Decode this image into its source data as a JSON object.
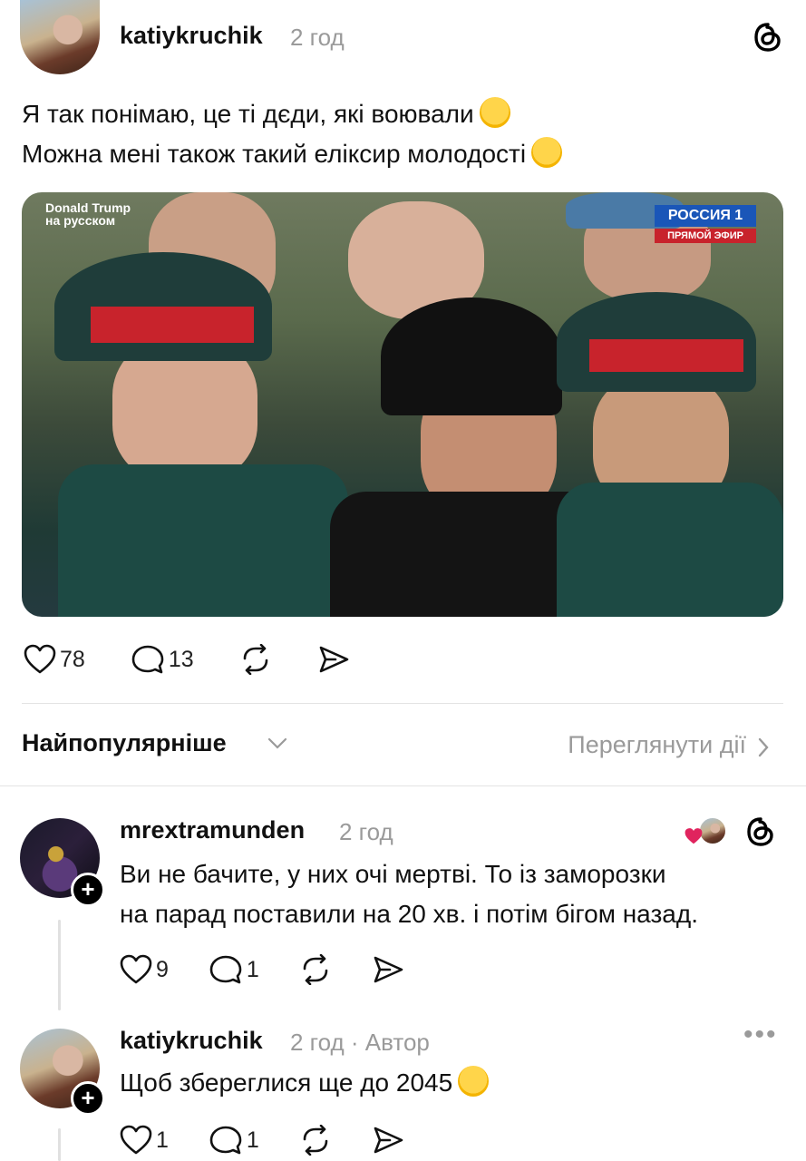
{
  "post": {
    "username": "katiykruchik",
    "time": "2 год",
    "text_line1": "Я так понімаю, це ті дєди, які воювали",
    "text_line2": "Можна мені також такий еліксир молодості",
    "photo_watermark_left": "Donald Trump\nна русском",
    "photo_watermark_right_channel": "РОССИЯ 1",
    "photo_watermark_right_live": "ПРЯМОЙ ЭФИР",
    "likes": "78",
    "comments": "13"
  },
  "sort": {
    "label": "Найпопулярніше",
    "activity_link": "Переглянути дії"
  },
  "replies": [
    {
      "username": "mrextramunden",
      "time": "2 год",
      "text_line1": "Ви не бачите, у них очі мертві. То із заморозки",
      "text_line2": "на парад поставили на 20 хв. і потім бігом назад.",
      "likes": "9",
      "comments": "1"
    },
    {
      "username": "katiykruchik",
      "time": "2 год · Автор",
      "text_line1": "Щоб збереглися ще до 2045",
      "likes": "1",
      "comments": "1"
    }
  ],
  "colors": {
    "text": "#111111",
    "muted": "#9a9a9a",
    "divider": "#e3e3e3",
    "heart_red": "#e0245e"
  },
  "icons": [
    "threads-icon",
    "heart-icon",
    "comment-icon",
    "repost-icon",
    "share-icon",
    "chevron-down-icon",
    "chevron-right-icon",
    "plus-icon",
    "more-icon"
  ]
}
